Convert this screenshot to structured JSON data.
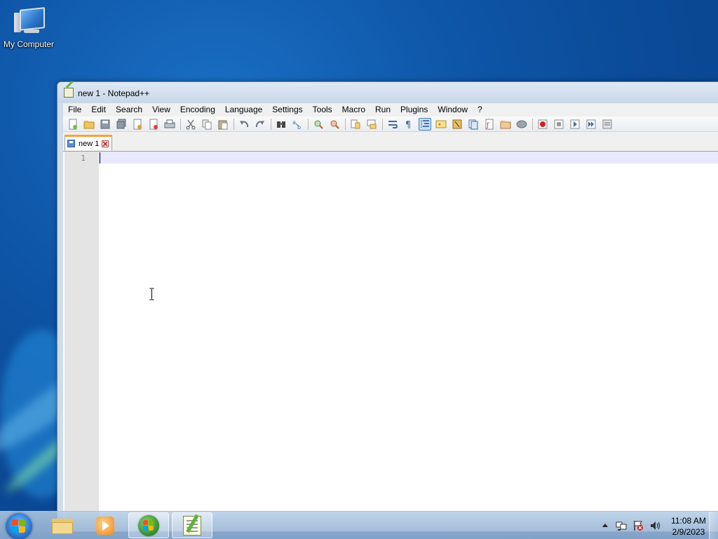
{
  "desktop": {
    "icons": [
      {
        "label": "My Computer",
        "icon": "computer-icon"
      }
    ]
  },
  "window": {
    "title": "new 1 - Notepad++",
    "menu": [
      "File",
      "Edit",
      "Search",
      "View",
      "Encoding",
      "Language",
      "Settings",
      "Tools",
      "Macro",
      "Run",
      "Plugins",
      "Window",
      "?"
    ],
    "toolbar": [
      "new-file-icon",
      "open-file-icon",
      "save-icon",
      "save-all-icon",
      "close-icon",
      "close-all-icon",
      "print-icon",
      "cut-icon",
      "copy-icon",
      "paste-icon",
      "undo-icon",
      "redo-icon",
      "find-icon",
      "replace-icon",
      "zoom-in-icon",
      "zoom-out-icon",
      "sync-vertical-icon",
      "sync-horizontal-icon",
      "word-wrap-icon",
      "show-all-characters-icon",
      "indent-guide-icon",
      "user-language-icon",
      "document-map-icon",
      "document-list-icon",
      "function-list-icon",
      "folder-workspace-icon",
      "monitoring-icon",
      "record-macro-icon",
      "stop-recording-icon",
      "playback-macro-icon",
      "run-macro-multiple-icon",
      "save-macro-icon"
    ],
    "tabs": [
      {
        "label": "new 1",
        "active": true
      }
    ],
    "editor": {
      "line_numbers": [
        "1"
      ],
      "content": ""
    }
  },
  "taskbar": {
    "pinned": [
      {
        "name": "windows-explorer",
        "icon": "folder-icon"
      },
      {
        "name": "media-center",
        "icon": "media-icon"
      },
      {
        "name": "windows-media-player",
        "icon": "wmp-icon"
      },
      {
        "name": "notepad-plus-plus",
        "icon": "notepad-plus-plus-icon",
        "active": true
      }
    ],
    "clock": {
      "time": "11:08 AM",
      "date": "2/9/2023"
    }
  },
  "colors": {
    "accent_tab": "#f7a13a",
    "current_line": "#e8e8ff",
    "gutter": "#e4e4e4"
  }
}
